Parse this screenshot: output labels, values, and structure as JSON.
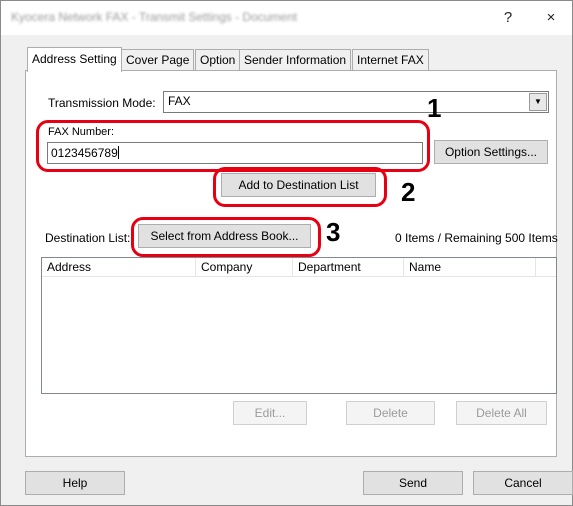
{
  "window": {
    "title": "Kyocera Network FAX - Transmit Settings - Document",
    "help_glyph": "?",
    "close_glyph": "×"
  },
  "tabs": [
    {
      "label": "Address Setting"
    },
    {
      "label": "Cover Page"
    },
    {
      "label": "Option"
    },
    {
      "label": "Sender Information"
    },
    {
      "label": "Internet FAX"
    }
  ],
  "transmission": {
    "label": "Transmission Mode:",
    "value": "FAX",
    "arrow": "▼"
  },
  "fax_number": {
    "label": "FAX Number:",
    "value": "0123456789"
  },
  "buttons": {
    "option_settings": "Option Settings...",
    "add_to_destination": "Add to Destination List",
    "select_address_book": "Select from Address Book...",
    "edit": "Edit...",
    "delete": "Delete",
    "delete_all": "Delete All",
    "help": "Help",
    "send": "Send",
    "cancel": "Cancel"
  },
  "destination": {
    "label": "Destination List:",
    "count_text": "0 Items / Remaining 500 Items"
  },
  "list_columns": [
    "Address",
    "Company",
    "Department",
    "Name"
  ],
  "callouts": [
    "1",
    "2",
    "3"
  ],
  "colors": {
    "highlight": "#e60012"
  }
}
